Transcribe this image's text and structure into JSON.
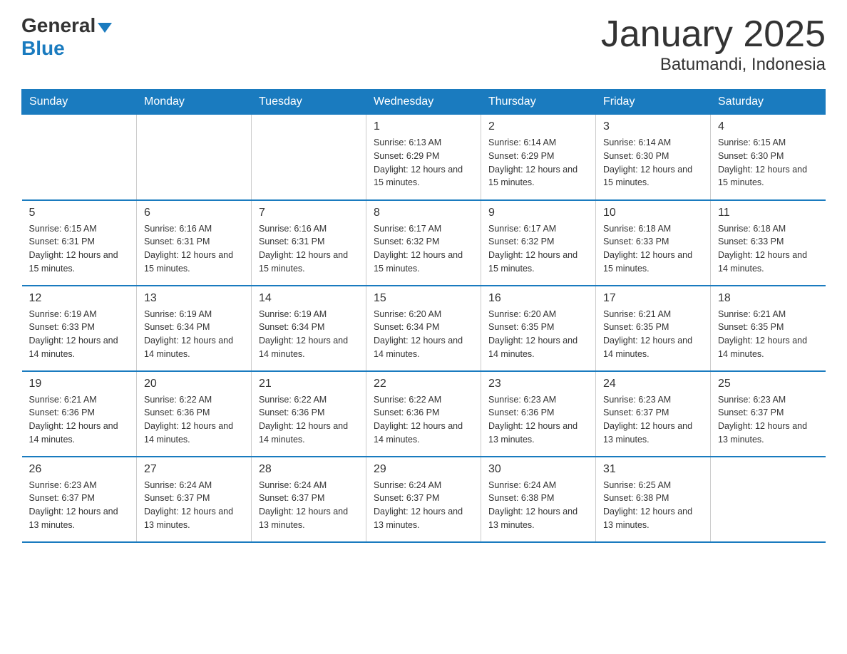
{
  "logo": {
    "text_general": "General",
    "text_blue": "Blue",
    "alt": "GeneralBlue logo"
  },
  "title": "January 2025",
  "subtitle": "Batumandi, Indonesia",
  "days_of_week": [
    "Sunday",
    "Monday",
    "Tuesday",
    "Wednesday",
    "Thursday",
    "Friday",
    "Saturday"
  ],
  "weeks": [
    [
      {
        "day": "",
        "info": ""
      },
      {
        "day": "",
        "info": ""
      },
      {
        "day": "",
        "info": ""
      },
      {
        "day": "1",
        "info": "Sunrise: 6:13 AM\nSunset: 6:29 PM\nDaylight: 12 hours and 15 minutes."
      },
      {
        "day": "2",
        "info": "Sunrise: 6:14 AM\nSunset: 6:29 PM\nDaylight: 12 hours and 15 minutes."
      },
      {
        "day": "3",
        "info": "Sunrise: 6:14 AM\nSunset: 6:30 PM\nDaylight: 12 hours and 15 minutes."
      },
      {
        "day": "4",
        "info": "Sunrise: 6:15 AM\nSunset: 6:30 PM\nDaylight: 12 hours and 15 minutes."
      }
    ],
    [
      {
        "day": "5",
        "info": "Sunrise: 6:15 AM\nSunset: 6:31 PM\nDaylight: 12 hours and 15 minutes."
      },
      {
        "day": "6",
        "info": "Sunrise: 6:16 AM\nSunset: 6:31 PM\nDaylight: 12 hours and 15 minutes."
      },
      {
        "day": "7",
        "info": "Sunrise: 6:16 AM\nSunset: 6:31 PM\nDaylight: 12 hours and 15 minutes."
      },
      {
        "day": "8",
        "info": "Sunrise: 6:17 AM\nSunset: 6:32 PM\nDaylight: 12 hours and 15 minutes."
      },
      {
        "day": "9",
        "info": "Sunrise: 6:17 AM\nSunset: 6:32 PM\nDaylight: 12 hours and 15 minutes."
      },
      {
        "day": "10",
        "info": "Sunrise: 6:18 AM\nSunset: 6:33 PM\nDaylight: 12 hours and 15 minutes."
      },
      {
        "day": "11",
        "info": "Sunrise: 6:18 AM\nSunset: 6:33 PM\nDaylight: 12 hours and 14 minutes."
      }
    ],
    [
      {
        "day": "12",
        "info": "Sunrise: 6:19 AM\nSunset: 6:33 PM\nDaylight: 12 hours and 14 minutes."
      },
      {
        "day": "13",
        "info": "Sunrise: 6:19 AM\nSunset: 6:34 PM\nDaylight: 12 hours and 14 minutes."
      },
      {
        "day": "14",
        "info": "Sunrise: 6:19 AM\nSunset: 6:34 PM\nDaylight: 12 hours and 14 minutes."
      },
      {
        "day": "15",
        "info": "Sunrise: 6:20 AM\nSunset: 6:34 PM\nDaylight: 12 hours and 14 minutes."
      },
      {
        "day": "16",
        "info": "Sunrise: 6:20 AM\nSunset: 6:35 PM\nDaylight: 12 hours and 14 minutes."
      },
      {
        "day": "17",
        "info": "Sunrise: 6:21 AM\nSunset: 6:35 PM\nDaylight: 12 hours and 14 minutes."
      },
      {
        "day": "18",
        "info": "Sunrise: 6:21 AM\nSunset: 6:35 PM\nDaylight: 12 hours and 14 minutes."
      }
    ],
    [
      {
        "day": "19",
        "info": "Sunrise: 6:21 AM\nSunset: 6:36 PM\nDaylight: 12 hours and 14 minutes."
      },
      {
        "day": "20",
        "info": "Sunrise: 6:22 AM\nSunset: 6:36 PM\nDaylight: 12 hours and 14 minutes."
      },
      {
        "day": "21",
        "info": "Sunrise: 6:22 AM\nSunset: 6:36 PM\nDaylight: 12 hours and 14 minutes."
      },
      {
        "day": "22",
        "info": "Sunrise: 6:22 AM\nSunset: 6:36 PM\nDaylight: 12 hours and 14 minutes."
      },
      {
        "day": "23",
        "info": "Sunrise: 6:23 AM\nSunset: 6:36 PM\nDaylight: 12 hours and 13 minutes."
      },
      {
        "day": "24",
        "info": "Sunrise: 6:23 AM\nSunset: 6:37 PM\nDaylight: 12 hours and 13 minutes."
      },
      {
        "day": "25",
        "info": "Sunrise: 6:23 AM\nSunset: 6:37 PM\nDaylight: 12 hours and 13 minutes."
      }
    ],
    [
      {
        "day": "26",
        "info": "Sunrise: 6:23 AM\nSunset: 6:37 PM\nDaylight: 12 hours and 13 minutes."
      },
      {
        "day": "27",
        "info": "Sunrise: 6:24 AM\nSunset: 6:37 PM\nDaylight: 12 hours and 13 minutes."
      },
      {
        "day": "28",
        "info": "Sunrise: 6:24 AM\nSunset: 6:37 PM\nDaylight: 12 hours and 13 minutes."
      },
      {
        "day": "29",
        "info": "Sunrise: 6:24 AM\nSunset: 6:37 PM\nDaylight: 12 hours and 13 minutes."
      },
      {
        "day": "30",
        "info": "Sunrise: 6:24 AM\nSunset: 6:38 PM\nDaylight: 12 hours and 13 minutes."
      },
      {
        "day": "31",
        "info": "Sunrise: 6:25 AM\nSunset: 6:38 PM\nDaylight: 12 hours and 13 minutes."
      },
      {
        "day": "",
        "info": ""
      }
    ]
  ]
}
